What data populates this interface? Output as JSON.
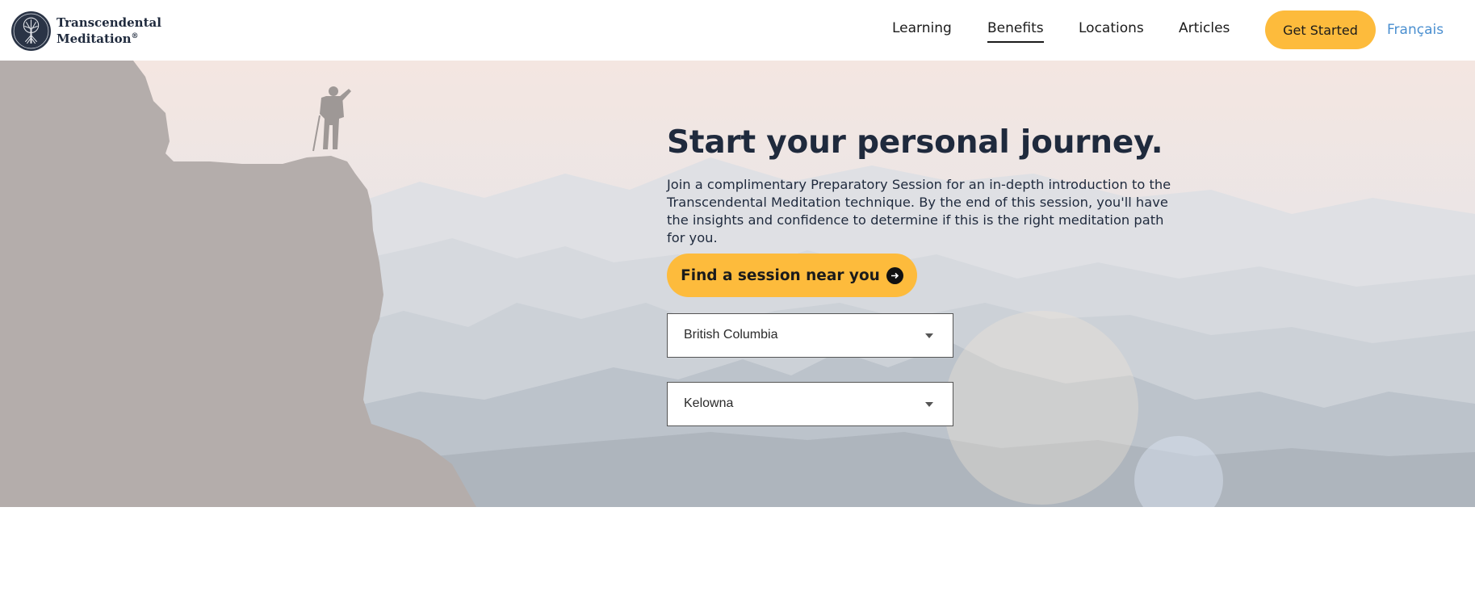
{
  "brand": {
    "name_line1": "Transcendental",
    "name_line2": "Meditation",
    "registered": "®"
  },
  "nav": {
    "items": [
      {
        "label": "Learning",
        "active": false
      },
      {
        "label": "Benefits",
        "active": true
      },
      {
        "label": "Locations",
        "active": false
      },
      {
        "label": "Articles",
        "active": false
      }
    ],
    "cta_label": "Get Started",
    "language_label": "Français"
  },
  "hero": {
    "title": "Start your personal journey.",
    "description": "Join a complimentary Preparatory Session for an in-depth introduction to the Transcendental Meditation technique. By the end of this session, you'll have the insights and confidence to determine if this is the right meditation path for you.",
    "find_button_label": "Find a session near you",
    "find_button_icon": "arrow-right-circle-icon",
    "region_select": {
      "selected": "British Columbia"
    },
    "city_select": {
      "selected": "Kelowna"
    }
  },
  "colors": {
    "accent": "#fdbb3c",
    "text_dark": "#1f2a3d",
    "link_blue": "#4a8fd0"
  }
}
